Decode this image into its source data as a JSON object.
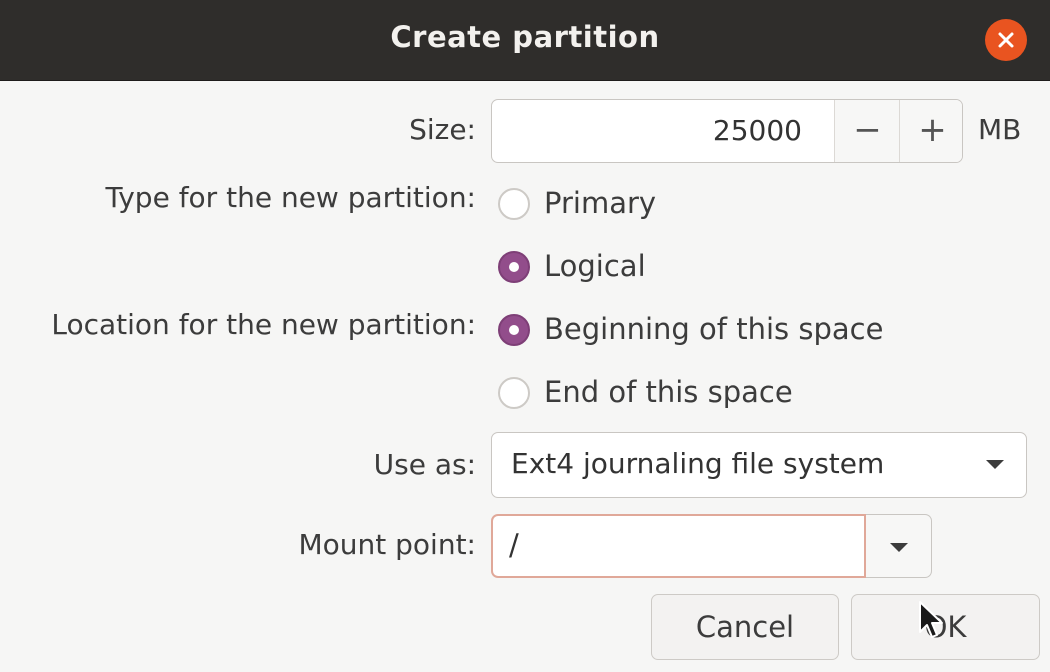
{
  "dialog": {
    "title": "Create partition",
    "close_icon": "close-icon",
    "accent_color": "#e95420",
    "radio_color": "#924d8b"
  },
  "size": {
    "label": "Size:",
    "value": "25000",
    "decrement": "−",
    "increment": "+",
    "unit": "MB"
  },
  "type": {
    "label": "Type for the new partition:",
    "options": [
      {
        "label": "Primary",
        "checked": false
      },
      {
        "label": "Logical",
        "checked": true
      }
    ]
  },
  "location": {
    "label": "Location for the new partition:",
    "options": [
      {
        "label": "Beginning of this space",
        "checked": true
      },
      {
        "label": "End of this space",
        "checked": false
      }
    ]
  },
  "use_as": {
    "label": "Use as:",
    "selected": "Ext4 journaling file system"
  },
  "mount_point": {
    "label": "Mount point:",
    "value": "/"
  },
  "buttons": {
    "cancel": "Cancel",
    "ok": "OK"
  }
}
